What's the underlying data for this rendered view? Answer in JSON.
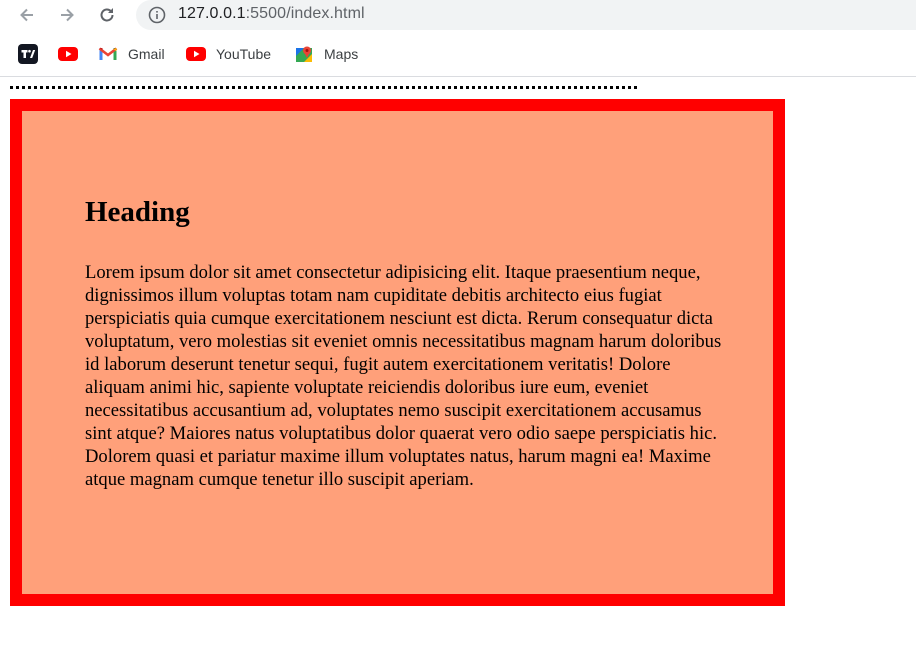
{
  "browser": {
    "url_host": "127.0.0.1",
    "url_port": ":5500",
    "url_path": "/index.html",
    "bookmarks": [
      {
        "label": "",
        "icon": "tradingview-icon"
      },
      {
        "label": "",
        "icon": "youtube-icon"
      },
      {
        "label": "Gmail",
        "icon": "gmail-icon"
      },
      {
        "label": "YouTube",
        "icon": "youtube-icon"
      },
      {
        "label": "Maps",
        "icon": "maps-icon"
      }
    ]
  },
  "page": {
    "heading": "Heading",
    "paragraph": "Lorem ipsum dolor sit amet consectetur adipisicing elit. Itaque praesentium neque, dignissimos illum voluptas totam nam cupiditate debitis architecto eius fugiat perspiciatis quia cumque exercitationem nesciunt est dicta. Rerum consequatur dicta voluptatum, vero molestias sit eveniet omnis necessitatibus magnam harum doloribus id laborum deserunt tenetur sequi, fugit autem exercitationem veritatis! Dolore aliquam animi hic, sapiente voluptate reiciendis doloribus iure eum, eveniet necessitatibus accusantium ad, voluptates nemo suscipit exercitationem accusamus sint atque? Maiores natus voluptatibus dolor quaerat vero odio saepe perspiciatis hic. Dolorem quasi et pariatur maxime illum voluptates natus, harum magni ea! Maxime atque magnam cumque tenetur illo suscipit aperiam."
  },
  "colors": {
    "box_background": "#ffa07a",
    "box_border": "#ff0000"
  }
}
